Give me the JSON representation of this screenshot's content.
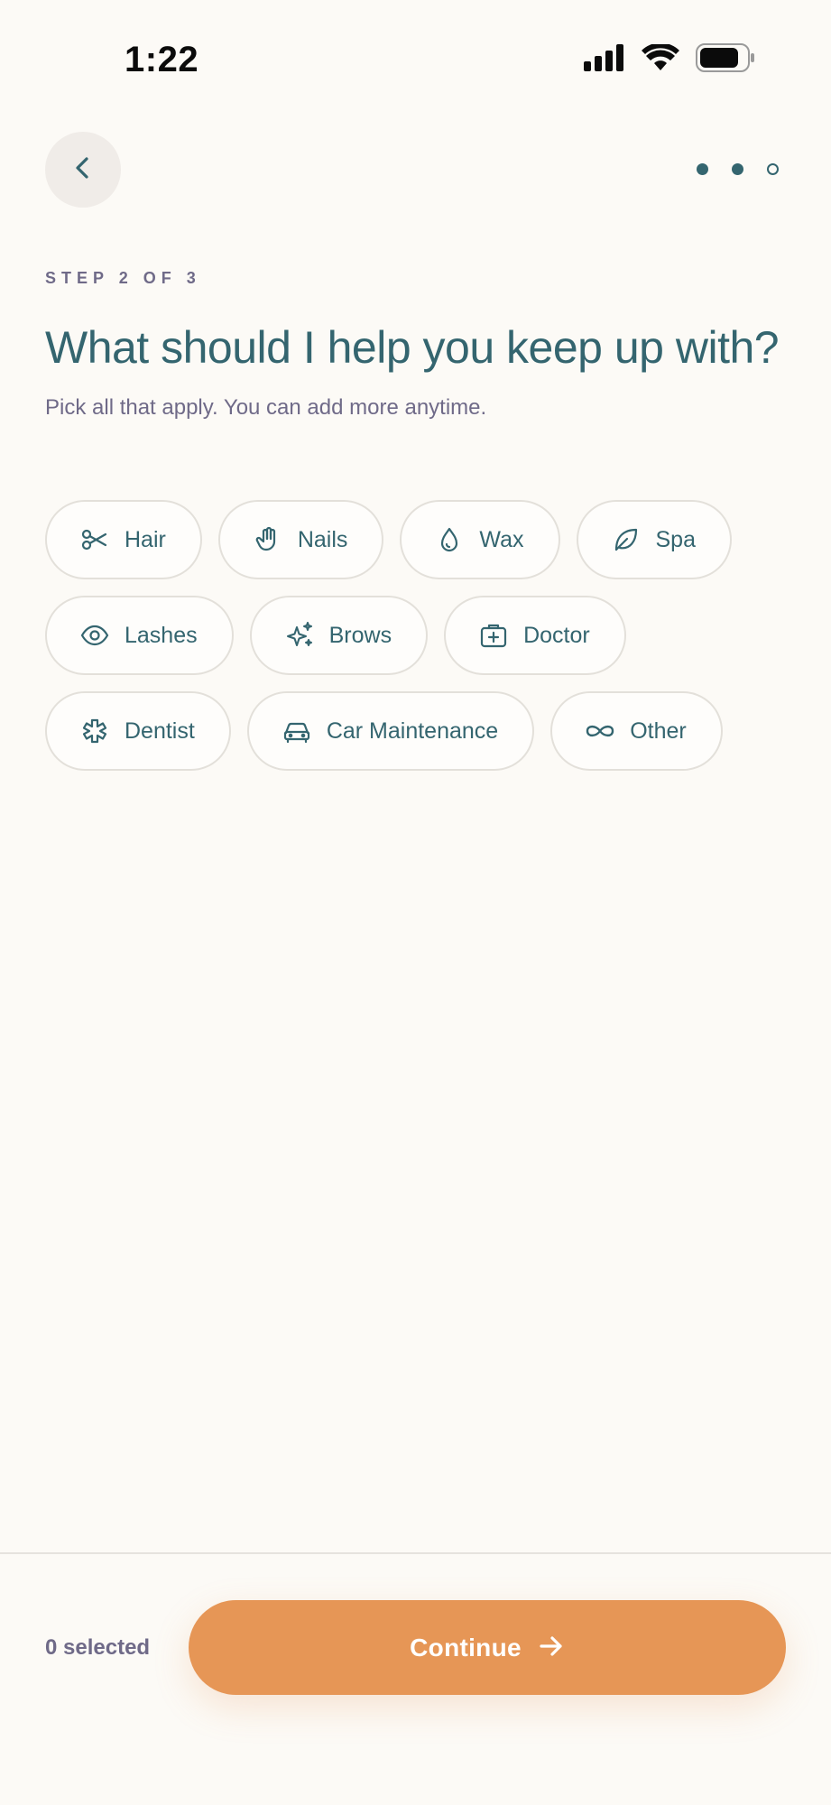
{
  "status_bar": {
    "time": "1:22",
    "icons": [
      "cellular-signal-icon",
      "wifi-icon",
      "battery-icon"
    ]
  },
  "nav": {
    "back_icon": "chevron-left-icon",
    "progress": {
      "total_steps": 3,
      "filled_steps": 2
    }
  },
  "header": {
    "step_label": "STEP 2 OF 3",
    "title": "What should I help you keep up with?",
    "subtitle": "Pick all that apply. You can add more anytime."
  },
  "chips": [
    {
      "label": "Hair",
      "icon": "scissors-icon"
    },
    {
      "label": "Nails",
      "icon": "hand-icon"
    },
    {
      "label": "Wax",
      "icon": "droplet-icon"
    },
    {
      "label": "Spa",
      "icon": "leaf-icon"
    },
    {
      "label": "Lashes",
      "icon": "eye-icon"
    },
    {
      "label": "Brows",
      "icon": "sparkles-icon"
    },
    {
      "label": "Doctor",
      "icon": "medical-kit-icon"
    },
    {
      "label": "Dentist",
      "icon": "asterisk-icon"
    },
    {
      "label": "Car Maintenance",
      "icon": "car-icon"
    },
    {
      "label": "Other",
      "icon": "infinity-icon"
    }
  ],
  "footer": {
    "selected_count": "0 selected",
    "continue_label": "Continue",
    "continue_icon": "arrow-right-icon"
  },
  "colors": {
    "background": "#fcfaf6",
    "primary_teal": "#34656f",
    "muted_text": "#6f6a88",
    "accent_orange": "#e69656",
    "chip_border": "#e3e0da"
  }
}
